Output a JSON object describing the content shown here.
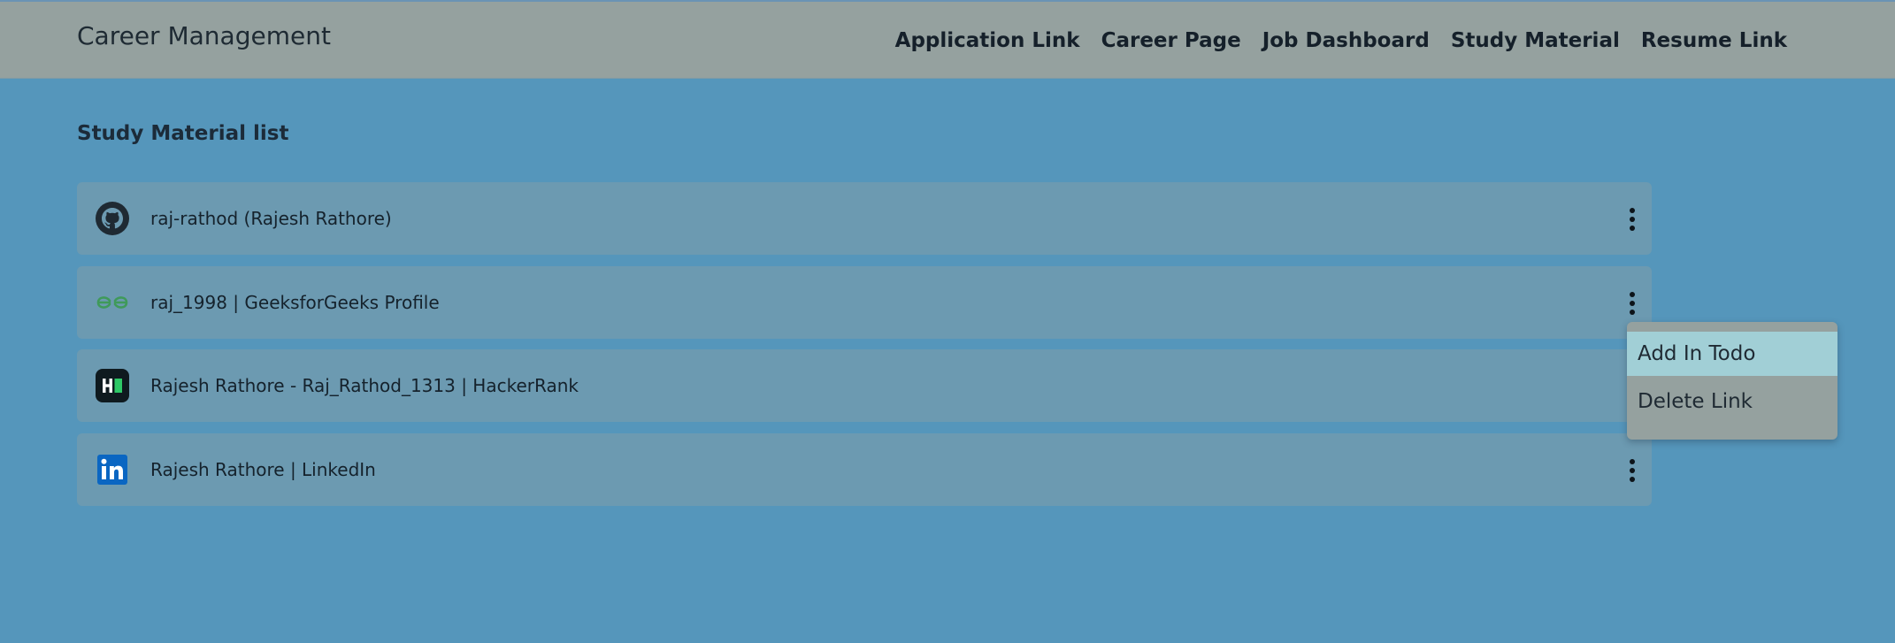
{
  "header": {
    "brand": "Career Management",
    "nav": [
      "Application Link",
      "Career Page",
      "Job Dashboard",
      "Study Material",
      "Resume Link"
    ]
  },
  "main": {
    "title": "Study Material list",
    "items": [
      {
        "label": "raj-rathod (Rajesh Rathore)",
        "icon": "github-icon"
      },
      {
        "label": "raj_1998 | GeeksforGeeks Profile",
        "icon": "geeksforgeeks-icon"
      },
      {
        "label": "Rajesh Rathore - Raj_Rathod_1313 | HackerRank",
        "icon": "hackerrank-icon"
      },
      {
        "label": "Rajesh Rathore | LinkedIn",
        "icon": "linkedin-icon"
      }
    ]
  },
  "context_menu": {
    "items": [
      "Add In Todo",
      "Delete Link"
    ],
    "highlighted": "Add In Todo"
  },
  "colors": {
    "background": "#5596bb",
    "navbar": "#95a19f",
    "card": "#6c9ab1",
    "menu_highlight": "#a1cfd6"
  }
}
